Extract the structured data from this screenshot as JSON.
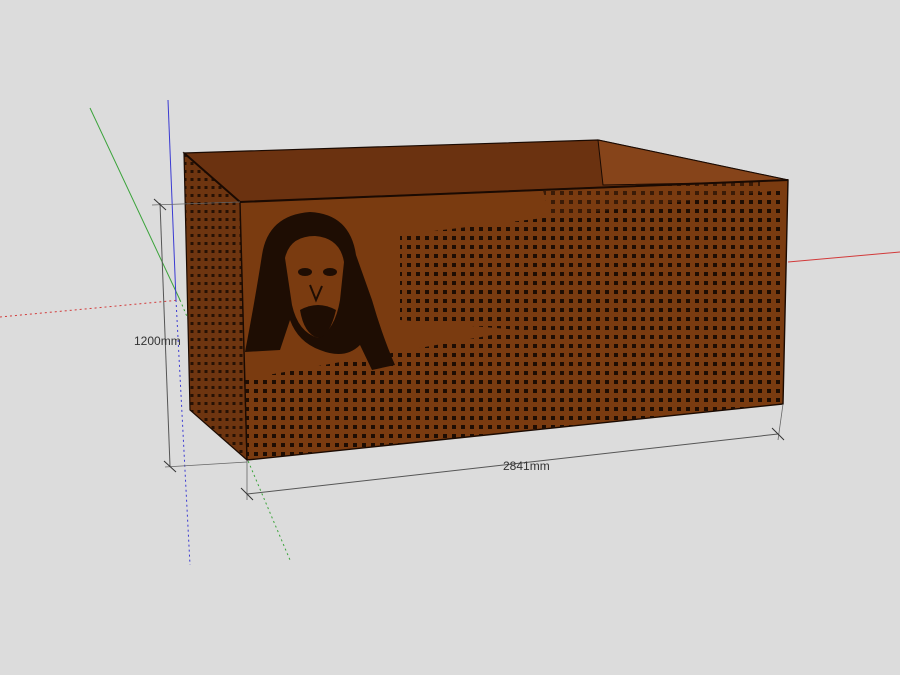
{
  "viewport": {
    "background": "#dcdcdc",
    "axes": {
      "red": "#d23a3a",
      "green": "#3aa33a",
      "blue": "#3a3ad2"
    }
  },
  "model": {
    "panel_color": "#7a3b10",
    "panel_dark": "#5a2a08",
    "perforation_color": "#1e0d03",
    "portrait_icon": "portrait-engraving-icon"
  },
  "dimensions": {
    "height": "1200mm",
    "width": "2841mm"
  }
}
